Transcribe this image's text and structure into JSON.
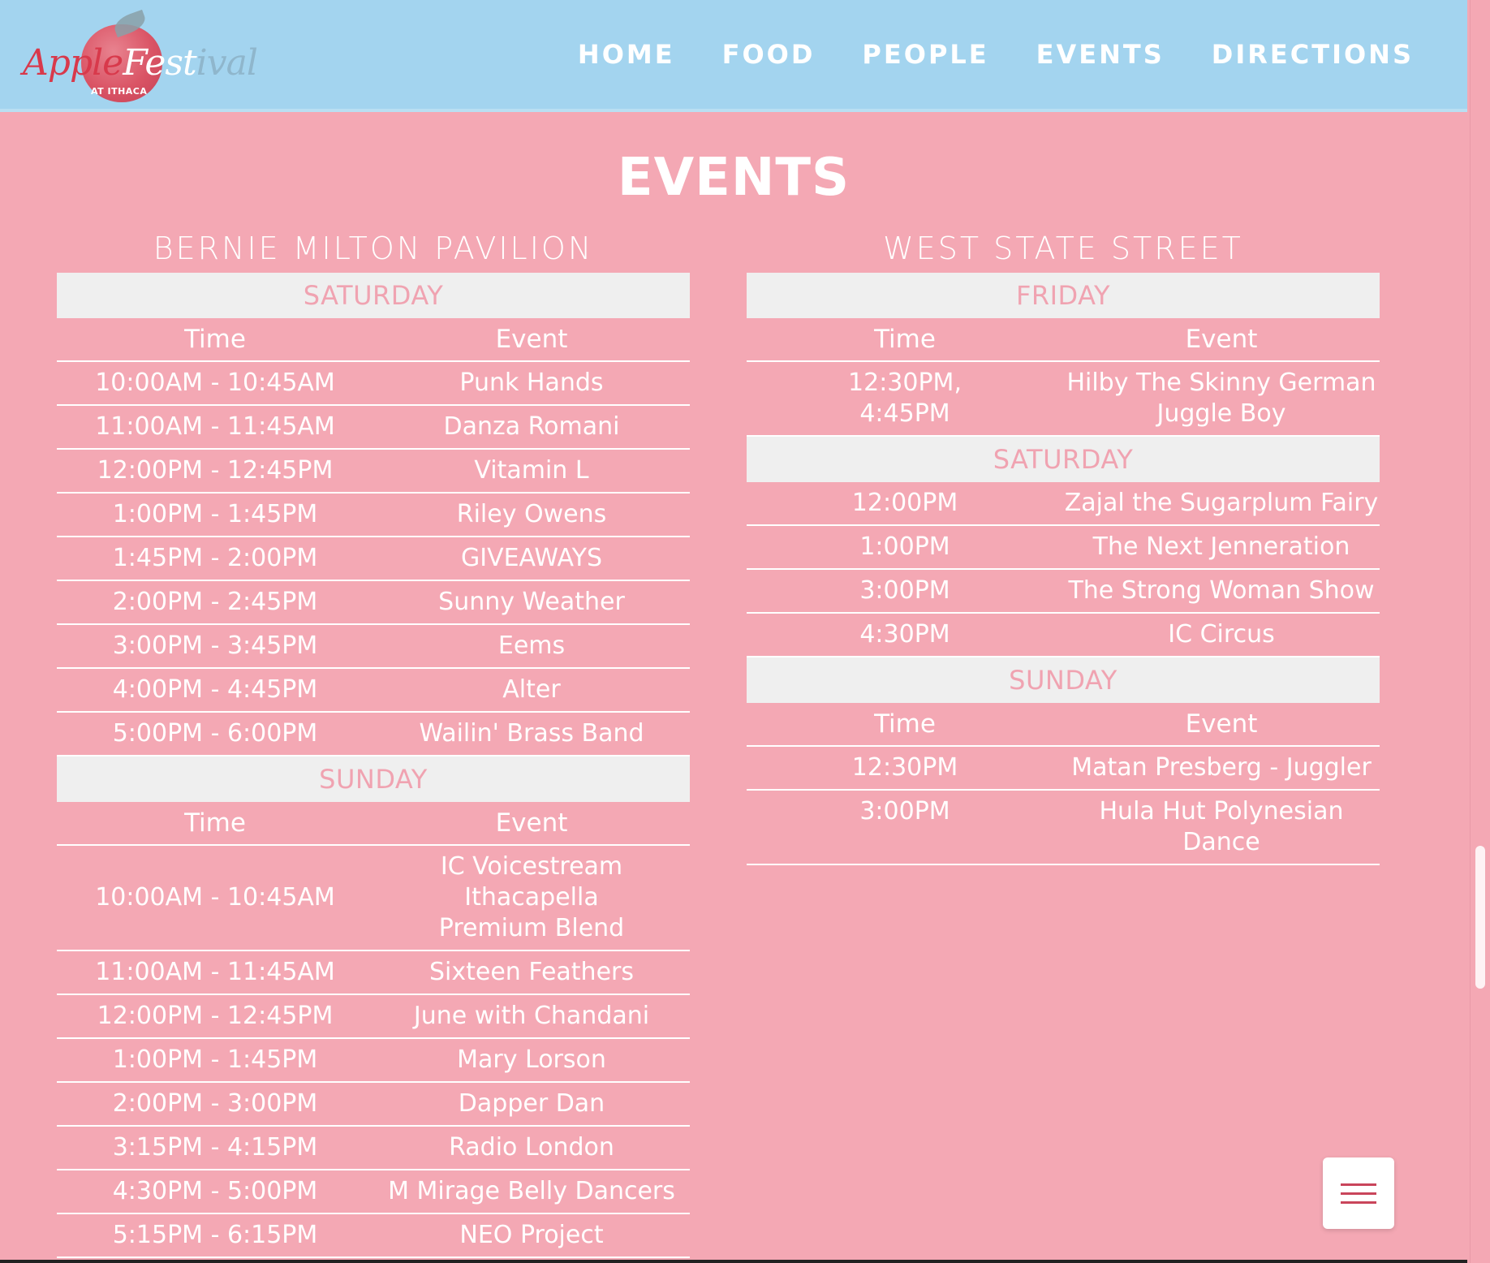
{
  "header": {
    "logo": {
      "part1": "Apple",
      "part2": "Fest",
      "part3": "ival",
      "subtitle": "AT ITHACA"
    },
    "nav": [
      "HOME",
      "FOOD",
      "PEOPLE",
      "EVENTS",
      "DIRECTIONS"
    ]
  },
  "page_title": "EVENTS",
  "venues": [
    {
      "name": "BERNIE MILTON PAVILION",
      "days": [
        {
          "name": "SATURDAY",
          "headers": {
            "time": "Time",
            "event": "Event"
          },
          "rows": [
            {
              "time": "10:00AM - 10:45AM",
              "event": "Punk Hands"
            },
            {
              "time": "11:00AM - 11:45AM",
              "event": "Danza Romani"
            },
            {
              "time": "12:00PM - 12:45PM",
              "event": "Vitamin L"
            },
            {
              "time": "1:00PM - 1:45PM",
              "event": "Riley Owens"
            },
            {
              "time": "1:45PM - 2:00PM",
              "event": "GIVEAWAYS"
            },
            {
              "time": "2:00PM - 2:45PM",
              "event": "Sunny Weather"
            },
            {
              "time": "3:00PM - 3:45PM",
              "event": "Eems"
            },
            {
              "time": "4:00PM - 4:45PM",
              "event": "Alter"
            },
            {
              "time": "5:00PM - 6:00PM",
              "event": "Wailin' Brass Band"
            }
          ]
        },
        {
          "name": "SUNDAY",
          "headers": {
            "time": "Time",
            "event": "Event"
          },
          "rows": [
            {
              "time": "10:00AM - 10:45AM",
              "event_lines": [
                "IC Voicestream",
                "Ithacapella",
                "Premium Blend"
              ]
            },
            {
              "time": "11:00AM - 11:45AM",
              "event": "Sixteen Feathers"
            },
            {
              "time": "12:00PM - 12:45PM",
              "event": "June with Chandani"
            },
            {
              "time": "1:00PM - 1:45PM",
              "event": "Mary Lorson"
            },
            {
              "time": "2:00PM - 3:00PM",
              "event": "Dapper Dan"
            },
            {
              "time": "3:15PM - 4:15PM",
              "event": "Radio London"
            },
            {
              "time": "4:30PM - 5:00PM",
              "event": "M Mirage Belly Dancers"
            },
            {
              "time": "5:15PM - 6:15PM",
              "event": "NEO Project"
            }
          ]
        }
      ]
    },
    {
      "name": "WEST STATE STREET",
      "days": [
        {
          "name": "FRIDAY",
          "headers": {
            "time": "Time",
            "event": "Event"
          },
          "rows": [
            {
              "time_lines": [
                "12:30PM,",
                "4:45PM"
              ],
              "event_lines": [
                "Hilby The Skinny German",
                "Juggle Boy"
              ]
            }
          ]
        },
        {
          "name": "SATURDAY",
          "rows": [
            {
              "time": "12:00PM",
              "event": "Zajal the Sugarplum Fairy"
            },
            {
              "time": "1:00PM",
              "event": "The Next Jenneration"
            },
            {
              "time": "3:00PM",
              "event": "The Strong Woman Show"
            },
            {
              "time": "4:30PM",
              "event": "IC Circus"
            }
          ]
        },
        {
          "name": "SUNDAY",
          "headers": {
            "time": "Time",
            "event": "Event"
          },
          "rows": [
            {
              "time": "12:30PM",
              "event": "Matan Presberg - Juggler"
            },
            {
              "time": "3:00PM",
              "event": "Hula Hut Polynesian Dance"
            }
          ]
        }
      ]
    }
  ],
  "icons": {
    "menu": "hamburger-menu-icon"
  },
  "colors": {
    "header_bg": "#a3d4ef",
    "page_bg": "#f4a8b4",
    "day_header_bg": "#efefef",
    "day_header_text": "#f0a3b1",
    "accent": "#c9455b"
  }
}
